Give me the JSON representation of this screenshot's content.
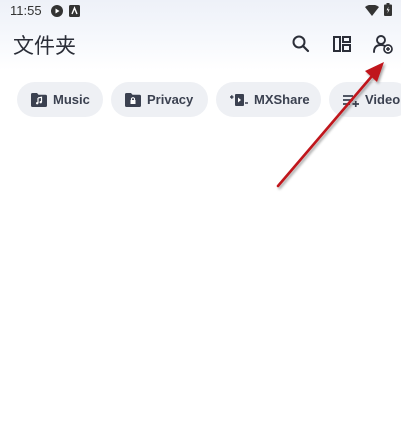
{
  "status_bar": {
    "time": "11:55",
    "left_icons": [
      "play-circle-icon",
      "app-notification-icon"
    ],
    "right_icons": [
      "wifi-icon",
      "battery-charging-icon"
    ]
  },
  "app_bar": {
    "title": "文件夹",
    "actions": [
      "search-icon",
      "layout-toggle-icon",
      "account-add-icon"
    ]
  },
  "chips": [
    {
      "label": "Music",
      "icon": "music-folder-icon"
    },
    {
      "label": "Privacy",
      "icon": "lock-folder-icon"
    },
    {
      "label": "MXShare",
      "icon": "share-icon"
    },
    {
      "label": "Video",
      "icon": "playlist-add-icon"
    }
  ],
  "colors": {
    "accent": "#c0141a",
    "chip_bg": "#eef0f4",
    "icon": "#3b4150"
  }
}
